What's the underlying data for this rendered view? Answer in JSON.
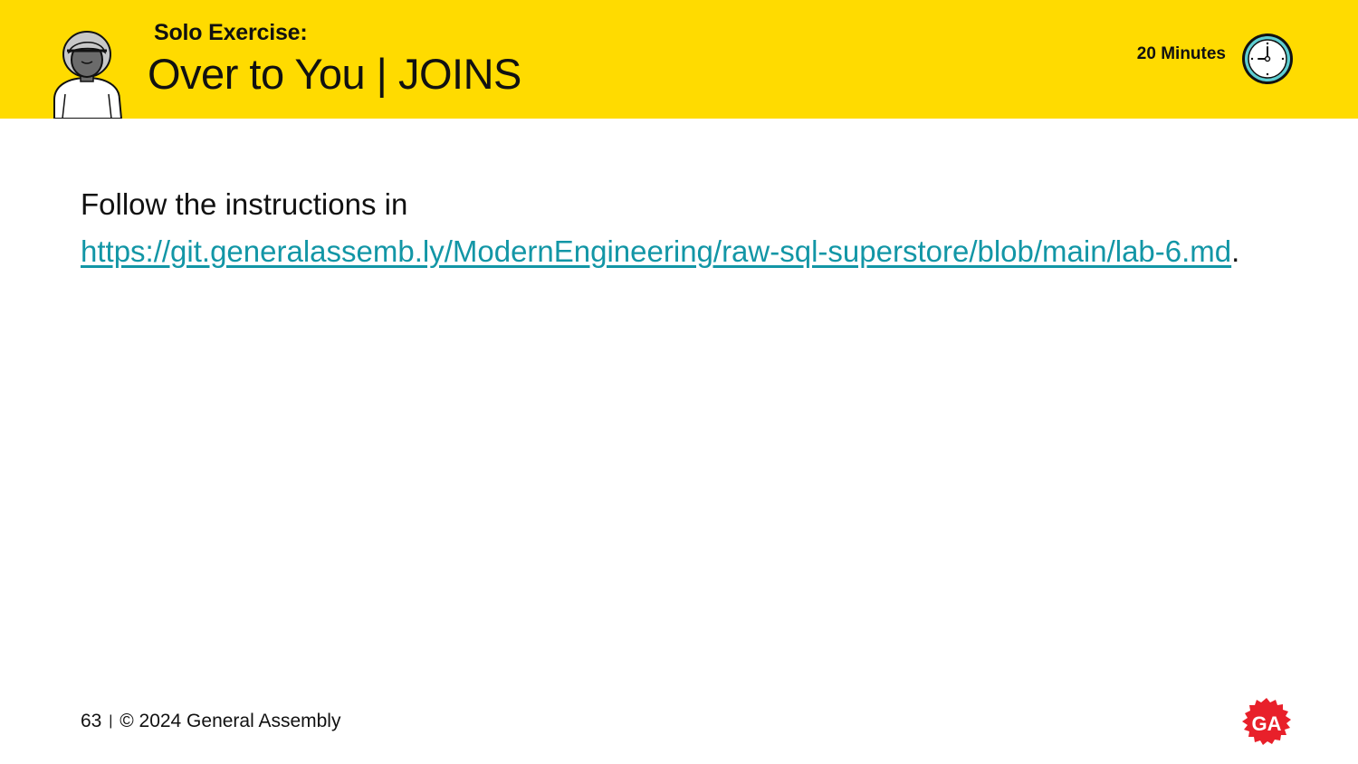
{
  "header": {
    "kicker": "Solo Exercise:",
    "title": "Over to You | JOINS",
    "duration": "20 Minutes",
    "avatar_icon": "person-avatar-icon",
    "clock_icon": "clock-icon",
    "background_color": "#ffdb00"
  },
  "body": {
    "intro": "Follow the instructions in",
    "link_text": "https://git.generalassemb.ly/ModernEngineering/raw-sql-superstore/blob/main/lab-6.md",
    "trailing": ".",
    "link_color": "#1296a6"
  },
  "footer": {
    "page_number": "63",
    "separator": "|",
    "copyright": "© 2024 General Assembly",
    "logo_icon": "ga-logo-icon",
    "logo_text": "GA",
    "logo_color": "#e8202a"
  }
}
